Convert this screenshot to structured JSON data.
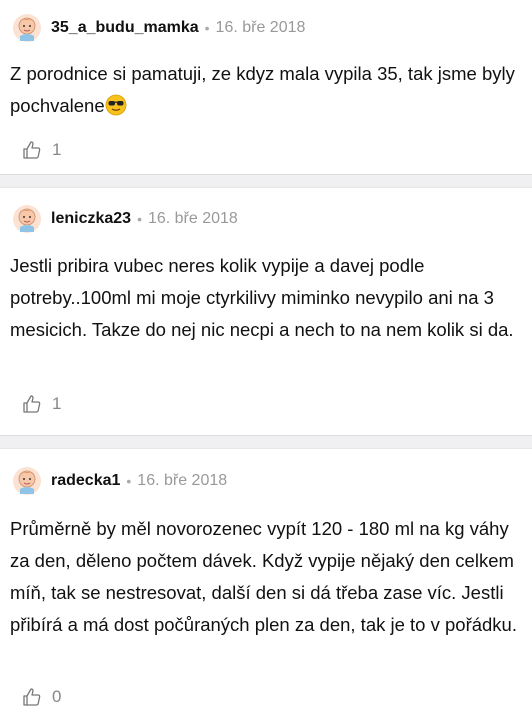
{
  "comments": [
    {
      "username": "35_a_budu_mamka",
      "separator": "•",
      "date": "16. bře 2018",
      "text": "Z porodnice si pamatuji, ze kdyz mala vypila 35, tak jsme byly pochvalene",
      "emoji": "sunglasses-emoji",
      "likes": "1"
    },
    {
      "username": "leniczka23",
      "separator": "•",
      "date": "16. bře 2018",
      "text": "Jestli pribira vubec neres kolik vypije a davej podle potreby..100ml mi moje ctyrkilivy miminko nevypilo ani na 3 mesicich. Takze do nej nic necpi a nech to na nem kolik si da.",
      "likes": "1"
    },
    {
      "username": "radecka1",
      "separator": "•",
      "date": "16. bře 2018",
      "text": "Průměrně by měl novorozenec vypít 120 - 180 ml na kg váhy za den, děleno počtem dávek. Když vypije nějaký den celkem míň, tak se nestresovat, další den si dá třeba zase víc. Jestli přibírá a má dost počůraných plen za den, tak je to v pořádku.",
      "likes": "0"
    }
  ],
  "icons": {
    "avatar": "baby-avatar-icon",
    "like": "thumbs-up-icon"
  },
  "colors": {
    "separator_bg": "#f0f0f2",
    "meta_text": "#999999",
    "avatar_skin": "#f6c7a8",
    "avatar_hair": "#e08a55"
  }
}
